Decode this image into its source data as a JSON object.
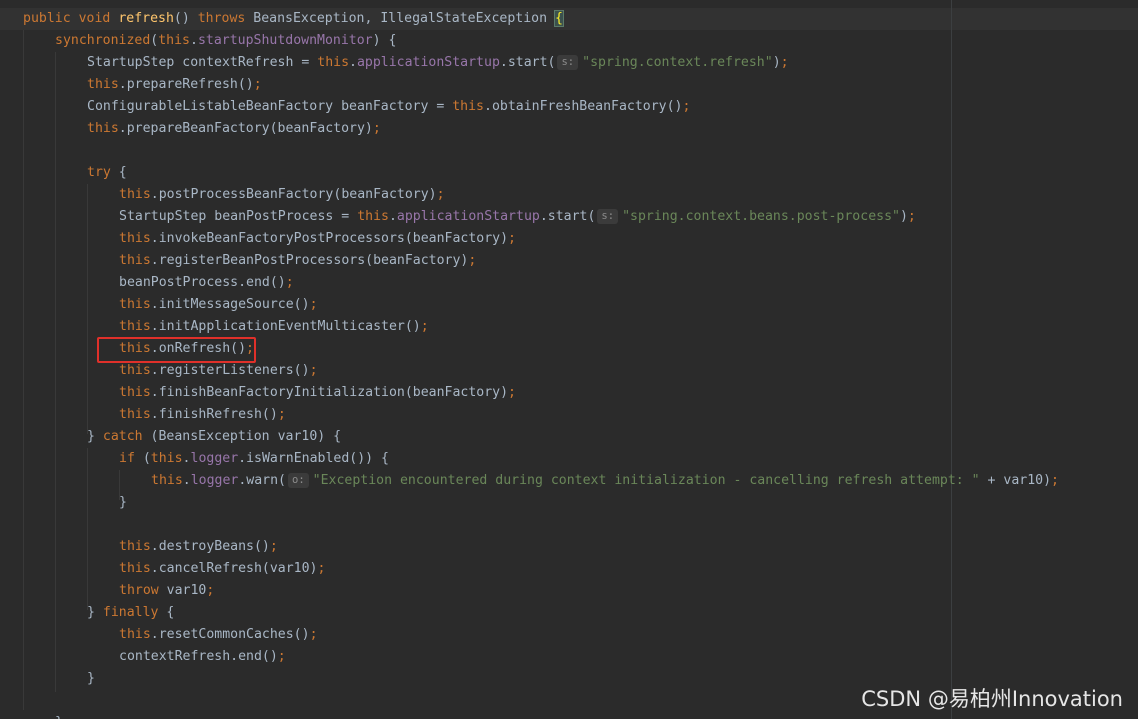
{
  "editor": {
    "lines": [
      {
        "tokens": [
          {
            "t": "public",
            "c": "kw"
          },
          {
            "t": " "
          },
          {
            "t": "void",
            "c": "kw"
          },
          {
            "t": " "
          },
          {
            "t": "refresh",
            "c": "fn"
          },
          {
            "t": "() "
          },
          {
            "t": "throws",
            "c": "kw"
          },
          {
            "t": " BeansException, IllegalStateException "
          },
          {
            "t": "{",
            "c": "brace-match"
          }
        ]
      },
      {
        "tokens": [
          {
            "t": "synchronized",
            "c": "kw"
          },
          {
            "t": "("
          },
          {
            "t": "this",
            "c": "kw"
          },
          {
            "t": "."
          },
          {
            "t": "startupShutdownMonitor",
            "c": "fld"
          },
          {
            "t": ") {"
          }
        ]
      },
      {
        "tokens": [
          {
            "t": "StartupStep contextRefresh = "
          },
          {
            "t": "this",
            "c": "kw"
          },
          {
            "t": "."
          },
          {
            "t": "applicationStartup",
            "c": "fld"
          },
          {
            "t": ".start("
          },
          {
            "t": "s:",
            "c": "hint"
          },
          {
            "t": "\"spring.context.refresh\"",
            "c": "str"
          },
          {
            "t": ")"
          },
          {
            "t": ";",
            "c": "kw"
          }
        ]
      },
      {
        "tokens": [
          {
            "t": "this",
            "c": "kw"
          },
          {
            "t": ".prepareRefresh()"
          },
          {
            "t": ";",
            "c": "kw"
          }
        ]
      },
      {
        "tokens": [
          {
            "t": "ConfigurableListableBeanFactory beanFactory = "
          },
          {
            "t": "this",
            "c": "kw"
          },
          {
            "t": ".obtainFreshBeanFactory()"
          },
          {
            "t": ";",
            "c": "kw"
          }
        ]
      },
      {
        "tokens": [
          {
            "t": "this",
            "c": "kw"
          },
          {
            "t": ".prepareBeanFactory(beanFactory)"
          },
          {
            "t": ";",
            "c": "kw"
          }
        ]
      },
      {
        "tokens": []
      },
      {
        "tokens": [
          {
            "t": "try",
            "c": "kw"
          },
          {
            "t": " {"
          }
        ]
      },
      {
        "tokens": [
          {
            "t": "this",
            "c": "kw"
          },
          {
            "t": ".postProcessBeanFactory(beanFactory)"
          },
          {
            "t": ";",
            "c": "kw"
          }
        ]
      },
      {
        "tokens": [
          {
            "t": "StartupStep beanPostProcess = "
          },
          {
            "t": "this",
            "c": "kw"
          },
          {
            "t": "."
          },
          {
            "t": "applicationStartup",
            "c": "fld"
          },
          {
            "t": ".start("
          },
          {
            "t": "s:",
            "c": "hint"
          },
          {
            "t": "\"spring.context.beans.post-process\"",
            "c": "str"
          },
          {
            "t": ")"
          },
          {
            "t": ";",
            "c": "kw"
          }
        ]
      },
      {
        "tokens": [
          {
            "t": "this",
            "c": "kw"
          },
          {
            "t": ".invokeBeanFactoryPostProcessors(beanFactory)"
          },
          {
            "t": ";",
            "c": "kw"
          }
        ]
      },
      {
        "tokens": [
          {
            "t": "this",
            "c": "kw"
          },
          {
            "t": ".registerBeanPostProcessors(beanFactory)"
          },
          {
            "t": ";",
            "c": "kw"
          }
        ]
      },
      {
        "tokens": [
          {
            "t": "beanPostProcess.end()"
          },
          {
            "t": ";",
            "c": "kw"
          }
        ]
      },
      {
        "tokens": [
          {
            "t": "this",
            "c": "kw"
          },
          {
            "t": ".initMessageSource()"
          },
          {
            "t": ";",
            "c": "kw"
          }
        ]
      },
      {
        "tokens": [
          {
            "t": "this",
            "c": "kw"
          },
          {
            "t": ".initApplicationEventMulticaster()"
          },
          {
            "t": ";",
            "c": "kw"
          }
        ]
      },
      {
        "tokens": [
          {
            "t": "this",
            "c": "kw"
          },
          {
            "t": ".onRefresh()"
          },
          {
            "t": ";",
            "c": "kw"
          }
        ]
      },
      {
        "tokens": [
          {
            "t": "this",
            "c": "kw"
          },
          {
            "t": ".registerListeners()"
          },
          {
            "t": ";",
            "c": "kw"
          }
        ]
      },
      {
        "tokens": [
          {
            "t": "this",
            "c": "kw"
          },
          {
            "t": ".finishBeanFactoryInitialization(beanFactory)"
          },
          {
            "t": ";",
            "c": "kw"
          }
        ]
      },
      {
        "tokens": [
          {
            "t": "this",
            "c": "kw"
          },
          {
            "t": ".finishRefresh()"
          },
          {
            "t": ";",
            "c": "kw"
          }
        ]
      },
      {
        "tokens": [
          {
            "t": "} "
          },
          {
            "t": "catch",
            "c": "kw"
          },
          {
            "t": " (BeansException var10) {"
          }
        ]
      },
      {
        "tokens": [
          {
            "t": "if",
            "c": "kw"
          },
          {
            "t": " ("
          },
          {
            "t": "this",
            "c": "kw"
          },
          {
            "t": "."
          },
          {
            "t": "logger",
            "c": "fld"
          },
          {
            "t": ".isWarnEnabled()) {"
          }
        ]
      },
      {
        "tokens": [
          {
            "t": "this",
            "c": "kw"
          },
          {
            "t": "."
          },
          {
            "t": "logger",
            "c": "fld"
          },
          {
            "t": ".warn("
          },
          {
            "t": "o:",
            "c": "hint"
          },
          {
            "t": "\"Exception encountered during context initialization - cancelling refresh attempt: \"",
            "c": "str"
          },
          {
            "t": " + var10)"
          },
          {
            "t": ";",
            "c": "kw"
          }
        ]
      },
      {
        "tokens": [
          {
            "t": "}"
          }
        ]
      },
      {
        "tokens": []
      },
      {
        "tokens": [
          {
            "t": "this",
            "c": "kw"
          },
          {
            "t": ".destroyBeans()"
          },
          {
            "t": ";",
            "c": "kw"
          }
        ]
      },
      {
        "tokens": [
          {
            "t": "this",
            "c": "kw"
          },
          {
            "t": ".cancelRefresh(var10)"
          },
          {
            "t": ";",
            "c": "kw"
          }
        ]
      },
      {
        "tokens": [
          {
            "t": "throw",
            "c": "kw"
          },
          {
            "t": " var10"
          },
          {
            "t": ";",
            "c": "kw"
          }
        ]
      },
      {
        "tokens": [
          {
            "t": "} "
          },
          {
            "t": "finally",
            "c": "kw"
          },
          {
            "t": " {"
          }
        ]
      },
      {
        "tokens": [
          {
            "t": "this",
            "c": "kw"
          },
          {
            "t": ".resetCommonCaches()"
          },
          {
            "t": ";",
            "c": "kw"
          }
        ]
      },
      {
        "tokens": [
          {
            "t": "contextRefresh.end()"
          },
          {
            "t": ";",
            "c": "kw"
          }
        ]
      },
      {
        "tokens": [
          {
            "t": "}"
          }
        ]
      },
      {
        "tokens": []
      },
      {
        "tokens": [
          {
            "t": "}"
          }
        ]
      }
    ]
  },
  "watermark": {
    "text": "CSDN @易柏州Innovation"
  },
  "colors": {
    "background": "#2b2b2b",
    "keyword": "#cc7832",
    "method": "#ffc66d",
    "field": "#9876aa",
    "string": "#6a8759",
    "text": "#a9b7c6",
    "highlight_box": "#e0302a"
  }
}
